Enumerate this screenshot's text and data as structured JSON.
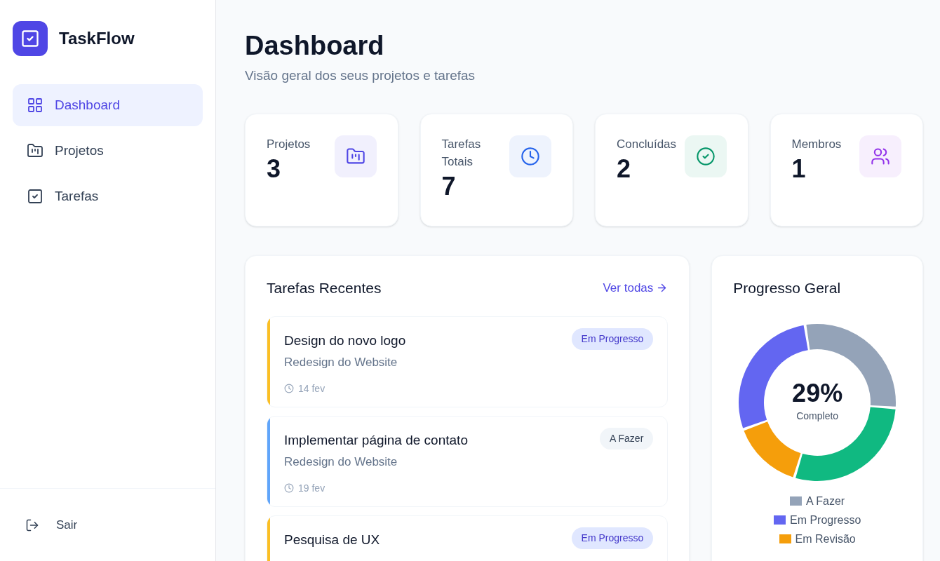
{
  "sidebar": {
    "brand": "TaskFlow",
    "items": [
      {
        "label": "Dashboard",
        "selected": true
      },
      {
        "label": "Projetos",
        "selected": false
      },
      {
        "label": "Tarefas",
        "selected": false
      }
    ],
    "logout": "Sair"
  },
  "header": {
    "title": "Dashboard",
    "subtitle": "Visão geral dos seus projetos e tarefas"
  },
  "stats": [
    {
      "label": "Projetos",
      "value": "3",
      "color": "#4f46e5"
    },
    {
      "label": "Tarefas Totais",
      "value": "7",
      "color": "#2563eb"
    },
    {
      "label": "Concluídas",
      "value": "2",
      "color": "#059669"
    },
    {
      "label": "Membros",
      "value": "1",
      "color": "#9333ea"
    }
  ],
  "recent_tasks": {
    "title": "Tarefas Recentes",
    "link": "Ver todas",
    "tasks": [
      {
        "title": "Design do novo logo",
        "project": "Redesign do Website",
        "date": "14 fev",
        "status": "Em Progresso",
        "kind": "in_progress",
        "color": "#fbbf24"
      },
      {
        "title": "Implementar página de contato",
        "project": "Redesign do Website",
        "date": "19 fev",
        "status": "A Fazer",
        "kind": "todo",
        "color": "#60a5fa"
      },
      {
        "title": "Pesquisa de UX",
        "status": "Em Progresso",
        "kind": "in_progress",
        "color": "#fbbf24"
      }
    ]
  },
  "progress": {
    "title": "Progresso Geral",
    "percent": "29%",
    "caption": "Completo",
    "legend": [
      {
        "label": "A Fazer",
        "color": "#94a3b8"
      },
      {
        "label": "Em Progresso",
        "color": "#6366f1"
      },
      {
        "label": "Em Revisão",
        "color": "#f59e0b"
      }
    ]
  }
}
